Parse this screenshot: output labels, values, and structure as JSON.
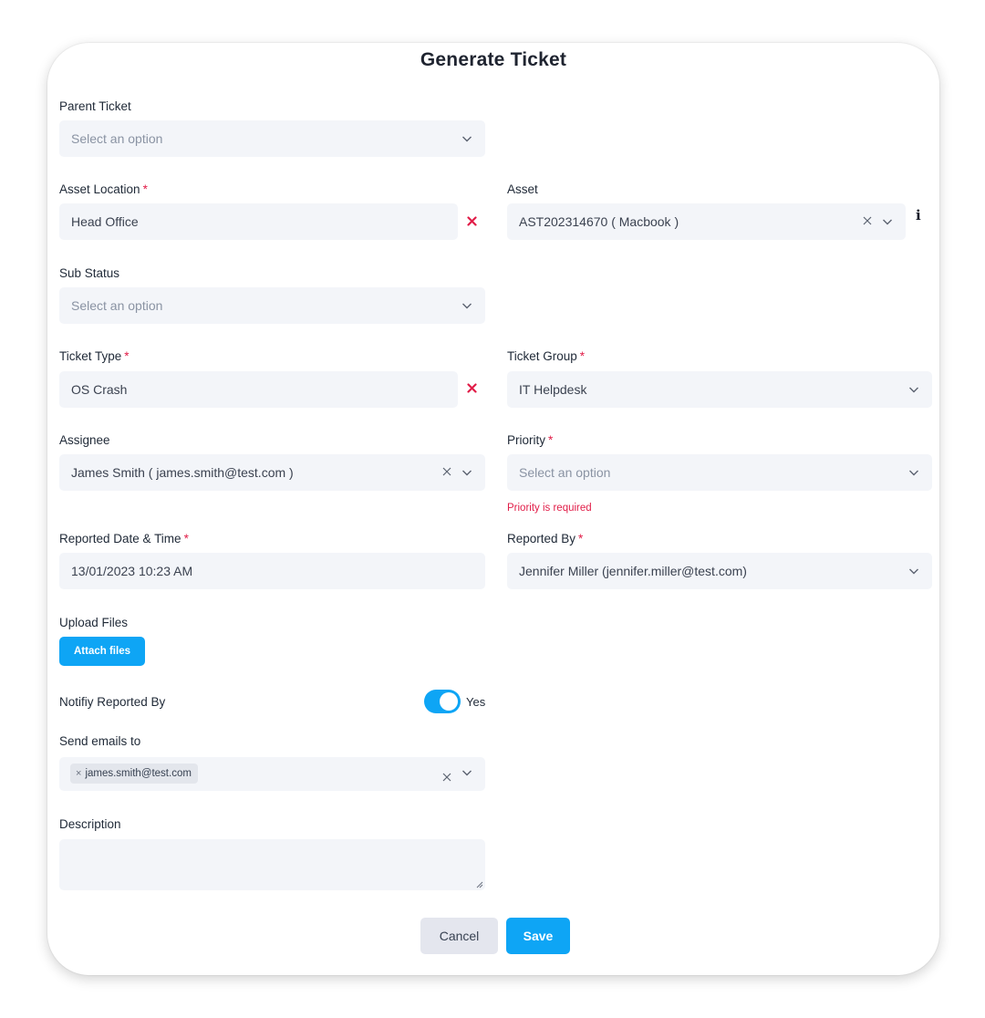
{
  "title": "Generate Ticket",
  "required_mark": "*",
  "parent_ticket": {
    "label": "Parent Ticket",
    "placeholder": "Select an option"
  },
  "asset_location": {
    "label": "Asset Location",
    "value": "Head Office"
  },
  "asset": {
    "label": "Asset",
    "value": "AST202314670 ( Macbook )",
    "info_icon": "i"
  },
  "sub_status": {
    "label": "Sub Status",
    "placeholder": "Select an option"
  },
  "ticket_type": {
    "label": "Ticket Type",
    "value": "OS Crash"
  },
  "ticket_group": {
    "label": "Ticket Group",
    "value": "IT Helpdesk"
  },
  "assignee": {
    "label": "Assignee",
    "value": "James Smith ( james.smith@test.com )"
  },
  "priority": {
    "label": "Priority",
    "placeholder": "Select an option",
    "error": "Priority is required"
  },
  "reported_date": {
    "label": "Reported Date & Time",
    "value": "13/01/2023 10:23 AM"
  },
  "reported_by": {
    "label": "Reported By",
    "value": "Jennifer Miller (jennifer.miller@test.com)"
  },
  "upload": {
    "label": "Upload Files",
    "button_label": "Attach files"
  },
  "notify": {
    "label": "Notifiy Reported By",
    "toggle_on": true,
    "toggle_label": "Yes"
  },
  "send_emails": {
    "label": "Send emails to",
    "chips": [
      "james.smith@test.com"
    ],
    "chip_remove": "×"
  },
  "description": {
    "label": "Description",
    "value": ""
  },
  "footer": {
    "cancel_label": "Cancel",
    "save_label": "Save"
  },
  "colors": {
    "accent": "#0ea5f5",
    "error": "#e11d48",
    "field_bg": "#f3f5f9"
  },
  "icons": {
    "dropdown": "chevron-down-icon",
    "clear": "close-icon",
    "remove_selection": "red-close-icon",
    "info": "info-icon"
  }
}
